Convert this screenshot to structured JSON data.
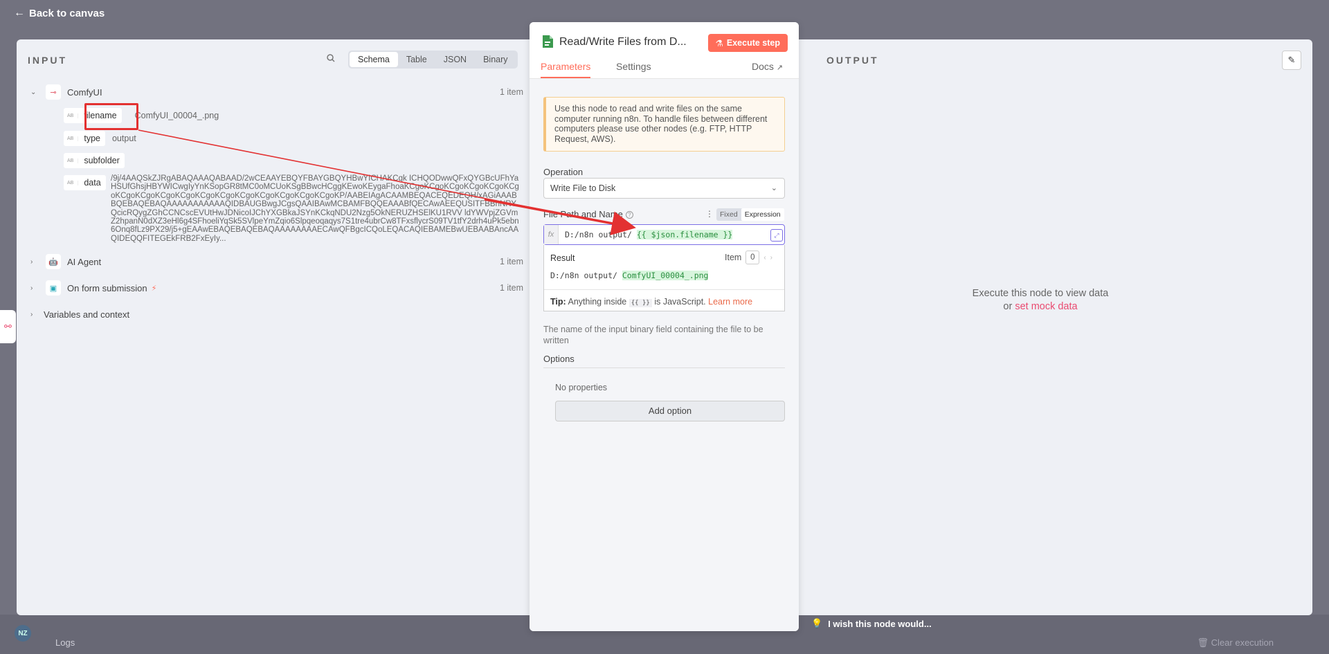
{
  "header": {
    "back_label": "Back to canvas"
  },
  "input_pane": {
    "title": "INPUT",
    "view_tabs": [
      "Schema",
      "Table",
      "JSON",
      "Binary"
    ],
    "active_tab": "Schema",
    "nodes": [
      {
        "name": "ComfyUI",
        "count": "1 item",
        "expanded": true,
        "fields": [
          {
            "type": "AB",
            "key": "filename",
            "value": "ComfyUI_00004_.png"
          },
          {
            "type": "AB",
            "key": "type",
            "value": "output"
          },
          {
            "type": "AB",
            "key": "subfolder",
            "value": ""
          },
          {
            "type": "AB",
            "key": "data",
            "value": "/9j/4AAQSkZJRgABAQAAAQABAAD/2wCEAAYEBQYFBAYGBQYHBwYICHAKCgk ICHQODwwQFxQYGBcUFhYaHSUfGhsjHBYWICwgIyYnKSopGR8tMC0oMCUoKSgBBwcHCggKEwoKEygaFhoaKCgoKCgoKCgoKCgoKCgoKCgoKCgoKCgoKCgoKCgoKCgoKCgoKCgoKCgoKCgoKCgoKCgoKP/AABEIAgACAAMBEQACEQEDEQH/xAGiAAABBQEBAQEBAQAAAAAAAAAAAQIDBAUGBwgJCgsQAAIBAwMCBAMFBQQEAAABfQECAwAEEQUSITFBBhNRYQcicRQygZGhCCNCscEVUtHwJDNicoIJChYXGBkaJSYnKCkqNDU2Nzg5OkNERUZHSElKU1RVV ldYWVpjZGVmZ2hpanN0dXZ3eHl6g4SFhoeliYqSk5SVlpeYmZqio6Slpqeoqaqys7S1tre4ubrCw8TFxsflycrS09TV1tfY2drh4uPk5ebn6Onq8fLz9PX29/j5+gEAAwEBAQEBAQEBAQAAAAAAAAECAwQFBgcICQoLEQACAQIEBAMEBwUEBAABAncAAQIDEQQFITEGEkFRB2FxEyIy..."
          }
        ]
      },
      {
        "name": "AI Agent",
        "count": "1 item",
        "expanded": false
      },
      {
        "name": "On form submission",
        "count": "1 item",
        "expanded": false
      }
    ],
    "variables_label": "Variables and context"
  },
  "modal": {
    "title": "Read/Write Files from D...",
    "execute_label": "Execute step",
    "tabs": [
      "Parameters",
      "Settings"
    ],
    "active_tab": "Parameters",
    "docs_label": "Docs",
    "notice": "Use this node to read and write files on the same computer running n8n. To handle files between different computers please use other nodes (e.g. FTP, HTTP Request, AWS).",
    "operation_label": "Operation",
    "operation_value": "Write File to Disk",
    "file_path_label": "File Path and Name",
    "mode_fixed": "Fixed",
    "mode_expression": "Expression",
    "expression_plain": "D:/n8n output/ ",
    "expression_var": "{{ $json.filename }}",
    "result_label": "Result",
    "item_label": "Item",
    "item_index": "0",
    "result_plain": "D:/n8n output/ ",
    "result_value": "ComfyUI_00004_.png",
    "tip_label": "Tip:",
    "tip_text_before": "Anything inside",
    "tip_code": "{{ }}",
    "tip_text_after": "is JavaScript.",
    "tip_link": "Learn more",
    "hidden_field_text": "The name of the input binary field containing the file to be written",
    "options_label": "Options",
    "no_properties": "No properties",
    "add_option_label": "Add option"
  },
  "output_pane": {
    "title": "OUTPUT",
    "empty_msg_line1": "Execute this node to view data",
    "empty_msg_or": "or",
    "empty_msg_link": "set mock data"
  },
  "footer": {
    "logs_label": "Logs",
    "clear_label": "Clear execution",
    "feedback_label": "I wish this node would...",
    "avatar_initials": "NZ"
  },
  "colors": {
    "accent": "#ff6d5a",
    "annotation": "#e33131",
    "expression_border": "#7c6fe5"
  }
}
